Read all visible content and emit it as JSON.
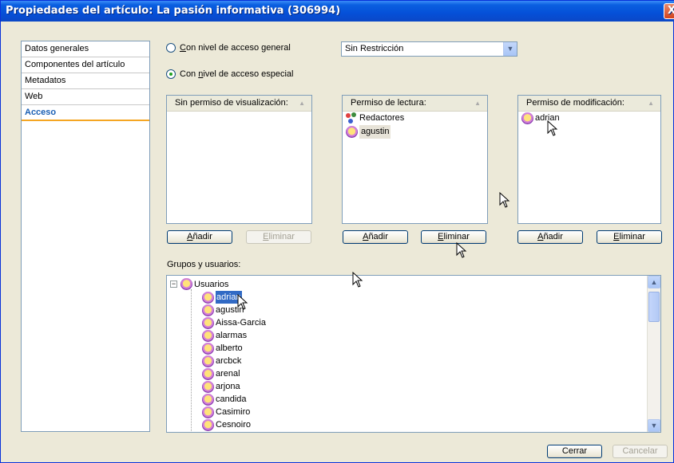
{
  "window": {
    "title": "Propiedades del artículo: La pasión informativa (306994)",
    "close_glyph": "X"
  },
  "nav": {
    "items": [
      "Datos generales",
      "Componentes del artículo",
      "Metadatos",
      "Web",
      "Acceso"
    ],
    "active": "Acceso"
  },
  "access": {
    "general_label": "Con nivel de acceso general",
    "general_accel": "C",
    "general_rest": "on nivel de acceso general",
    "special_label": "Con nivel de acceso especial",
    "special_accel": "n",
    "special_pre": "Con ",
    "special_rest": "ivel de acceso especial",
    "selected": "special",
    "select_value": "Sin Restricción"
  },
  "panels": [
    {
      "header": "Sin permiso de visualización:",
      "items": [],
      "add_label": "Añadir",
      "remove_label": "Eliminar"
    },
    {
      "header": "Permiso de lectura:",
      "items": [
        {
          "type": "group",
          "name": "Redactores"
        },
        {
          "type": "user",
          "name": "agustin"
        }
      ],
      "add_label": "Añadir",
      "remove_label": "Eliminar"
    },
    {
      "header": "Permiso de modificación:",
      "items": [
        {
          "type": "user",
          "name": "adrian"
        }
      ],
      "add_label": "Añadir",
      "remove_label": "Eliminar"
    }
  ],
  "groups": {
    "label": "Grupos y usuarios:",
    "root": "Usuarios",
    "users": [
      "adrian",
      "agustin",
      "Aissa-Garcia",
      "alarmas",
      "alberto",
      "arcbck",
      "arenal",
      "arjona",
      "candida",
      "Casimiro",
      "Cesnoiro"
    ],
    "selected": "adrian"
  },
  "footer": {
    "close_label": "Cerrar",
    "cancel_label": "Cancelar"
  },
  "icons": {
    "user": "user-icon",
    "group": "group-icon",
    "close": "close-icon",
    "dropdown": "chevron-down-icon"
  }
}
